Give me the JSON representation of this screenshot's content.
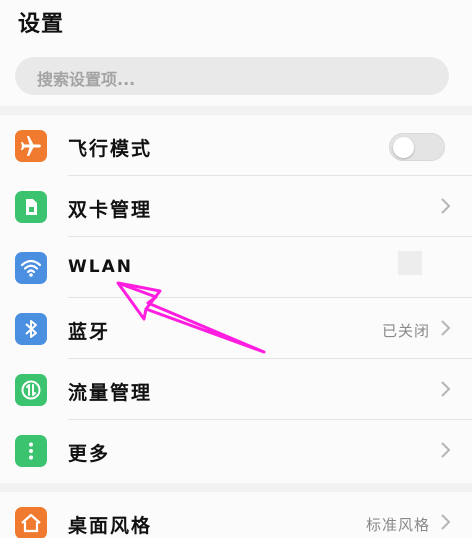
{
  "header": {
    "title": "设置"
  },
  "search": {
    "placeholder": "搜索设置项..."
  },
  "settings": [
    {
      "label": "飞行模式",
      "icon": "airplane-icon",
      "color": "#f07a2e",
      "control": "toggle",
      "toggle_on": false
    },
    {
      "label": "双卡管理",
      "icon": "sim-card-icon",
      "color": "#3cc36f",
      "control": "chevron"
    },
    {
      "label": "WLAN",
      "icon": "wifi-icon",
      "color": "#4a8fe0",
      "control": "none"
    },
    {
      "label": "蓝牙",
      "value": "已关闭",
      "icon": "bluetooth-icon",
      "color": "#4a8fe0",
      "control": "chevron"
    },
    {
      "label": "流量管理",
      "icon": "data-usage-icon",
      "color": "#3cc36f",
      "control": "chevron"
    },
    {
      "label": "更多",
      "icon": "more-icon",
      "color": "#3cc36f",
      "control": "chevron"
    }
  ],
  "settings2": [
    {
      "label": "桌面风格",
      "value": "标准风格",
      "icon": "home-icon",
      "color": "#f07a2e",
      "control": "chevron"
    }
  ],
  "annotation": {
    "color": "#ff1ee0"
  }
}
